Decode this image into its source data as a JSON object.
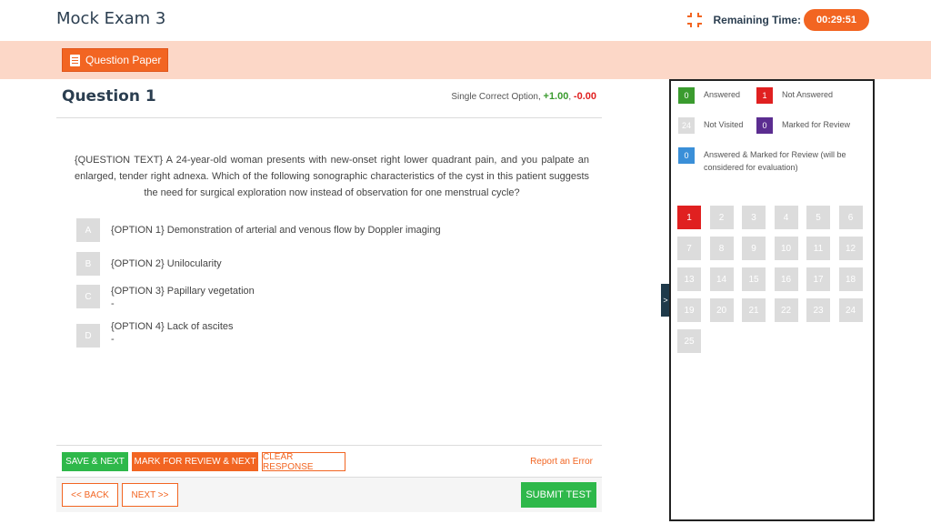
{
  "header": {
    "exam_title": "Mock Exam 3",
    "timer_label": "Remaining Time:",
    "timer_value": "00:29:51",
    "timer_icon": "collapse-arrows-icon"
  },
  "band": {
    "question_paper_label": "Question Paper",
    "question_paper_icon": "clipboard-icon"
  },
  "question": {
    "number_label": "Question 1",
    "type_label": "Single Correct Option,",
    "positive_marks": "+1.00",
    "separator": ",",
    "negative_marks": "-0.00",
    "text": "{QUESTION TEXT} A 24-year-old woman presents with new-onset right lower quadrant pain, and you palpate an enlarged, tender right adnexa. Which of the following sonographic characteristics of the cyst in this patient suggests the need for surgical exploration now instead of observation for one menstrual cycle?",
    "options": [
      {
        "letter": "A",
        "text": "{OPTION 1} Demonstration of arterial and venous flow by Doppler imaging",
        "sub": ""
      },
      {
        "letter": "B",
        "text": "{OPTION 2} Unilocularity",
        "sub": ""
      },
      {
        "letter": "C",
        "text": "{OPTION 3} Papillary vegetation",
        "sub": "-"
      },
      {
        "letter": "D",
        "text": "{OPTION 4} Lack of ascites",
        "sub": "-"
      }
    ]
  },
  "actions": {
    "save_next": "SAVE & NEXT",
    "mark_review_next": "MARK FOR REVIEW & NEXT",
    "clear_response": "CLEAR RESPONSE",
    "report_error": "Report an Error"
  },
  "nav": {
    "back": "<< BACK",
    "next": "NEXT >>",
    "submit": "SUBMIT TEST"
  },
  "palette": {
    "collapse_label": ">",
    "legend": {
      "answered": {
        "count": "0",
        "label": "Answered",
        "color": "#3a9b2e"
      },
      "not_answered": {
        "count": "1",
        "label": "Not Answered",
        "color": "#e02020"
      },
      "not_visited": {
        "count": "24",
        "label": "Not Visited",
        "color": "#dcdcdc"
      },
      "marked_review": {
        "count": "0",
        "label": "Marked for Review",
        "color": "#5b2d90"
      },
      "answered_marked": {
        "count": "0",
        "label": "Answered & Marked for Review (will be considered for evaluation)",
        "color": "#3a8fd8"
      }
    },
    "questions": [
      "1",
      "2",
      "3",
      "4",
      "5",
      "6",
      "7",
      "8",
      "9",
      "10",
      "11",
      "12",
      "13",
      "14",
      "15",
      "16",
      "17",
      "18",
      "19",
      "20",
      "21",
      "22",
      "23",
      "24",
      "25"
    ],
    "current_question_color": "#e02020"
  }
}
